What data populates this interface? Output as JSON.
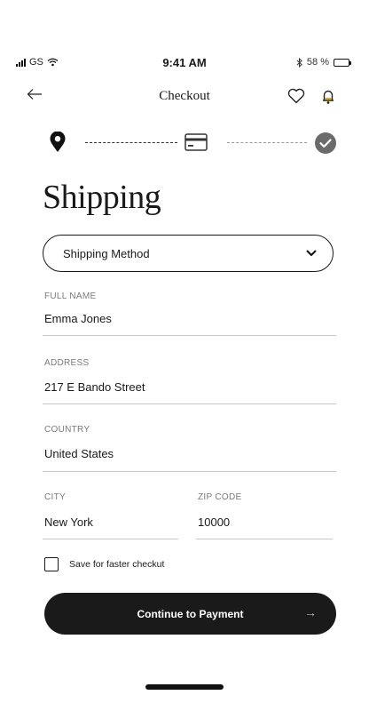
{
  "status_bar": {
    "carrier": "GS",
    "time": "9:41 AM",
    "battery_text": "58 %",
    "battery_level": 0.58
  },
  "header": {
    "title": "Checkout",
    "back_icon": "arrow-left-icon",
    "favorite_icon": "heart-icon",
    "notification_icon": "bell-icon"
  },
  "stepper": {
    "steps": [
      "location-pin-icon",
      "credit-card-icon",
      "check-circle-icon"
    ]
  },
  "page": {
    "heading": "Shipping"
  },
  "shipping_method": {
    "label": "Shipping Method"
  },
  "form": {
    "full_name": {
      "label": "FULL NAME",
      "value": "Emma Jones"
    },
    "address": {
      "label": "ADDRESS",
      "value": "217 E Bando Street"
    },
    "country": {
      "label": "COUNTRY",
      "value": "United States"
    },
    "city": {
      "label": "CITY",
      "value": "New York"
    },
    "zip": {
      "label": "ZIP CODE",
      "value": "10000"
    },
    "save_checkbox": {
      "label": "Save for faster checkut",
      "checked": false
    }
  },
  "cta": {
    "label": "Continue to Payment",
    "arrow": "→"
  },
  "colors": {
    "primary": "#1a1a1a",
    "accent_bell": "#d4a017",
    "step_check": "#6b6b6b",
    "muted_label": "#7a7a7a"
  }
}
